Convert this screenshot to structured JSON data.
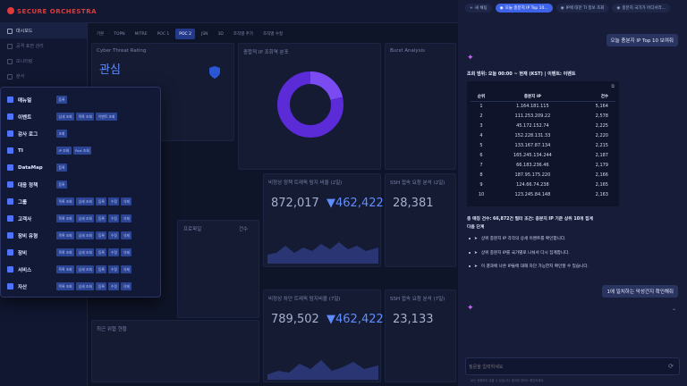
{
  "app": {
    "logo": "SECURE ORCHESTRA"
  },
  "sidebar": {
    "items": [
      {
        "label": "대시보드"
      },
      {
        "label": "공격 표면 관리"
      },
      {
        "label": "모니터링"
      },
      {
        "label": "분석"
      },
      {
        "label": "대응"
      }
    ]
  },
  "main_tabs": [
    {
      "label": "기본"
    },
    {
      "label": "TOPN"
    },
    {
      "label": "MITRE"
    },
    {
      "label": "POC 1"
    },
    {
      "label": "POC 2"
    },
    {
      "label": "JSN"
    },
    {
      "label": "3D"
    },
    {
      "label": "조직별 추가"
    },
    {
      "label": "조직별 수정"
    }
  ],
  "panels": {
    "cyber": {
      "title": "Cyber Threat Rating",
      "value": "관심"
    },
    "donut": {
      "title": "종합적 IP 조회역 분포"
    },
    "burst": {
      "title": "Burst Analysis"
    },
    "mid_left": {
      "title": "비정상 정책 트래픽 탐지 비율 (2일)",
      "v1": "872,017",
      "v2": "462,422"
    },
    "mid_right": {
      "title": "SSH 접속 요청 분석 (2일)",
      "v1": "28,381"
    },
    "low_left": {
      "title": "비정상 차단 트래픽 탐지비율 (7일)",
      "v1": "789,502",
      "v2": "462,422"
    },
    "low_right": {
      "title": "SSH 접속 요청 분석 (7일)",
      "v1": "23,133"
    },
    "recent": {
      "title": "최근 위협 현황"
    },
    "profile": {
      "h1": "프로파일",
      "h2": "건수"
    }
  },
  "menu": {
    "items": [
      {
        "label": "매뉴얼",
        "chips": [
          "등록"
        ]
      },
      {
        "label": "이벤트",
        "chips": [
          "상세 조회",
          "목록 조회",
          "이벤트 조회"
        ]
      },
      {
        "label": "감사 로그",
        "chips": [
          "조회"
        ]
      },
      {
        "label": "TI",
        "chips": [
          "IP 조회",
          "Port 조회"
        ]
      },
      {
        "label": "DataMap",
        "chips": [
          "등록"
        ]
      },
      {
        "label": "대응 정책",
        "chips": [
          "등록"
        ]
      },
      {
        "label": "그룹",
        "chips": [
          "목록 조회",
          "상세 조회",
          "등록",
          "수정",
          "삭제"
        ]
      },
      {
        "label": "고객사",
        "chips": [
          "목록 조회",
          "상세 조회",
          "등록",
          "수정",
          "삭제"
        ]
      },
      {
        "label": "장비 유형",
        "chips": [
          "목록 조회",
          "상세 조회",
          "등록",
          "수정",
          "삭제"
        ]
      },
      {
        "label": "장비",
        "chips": [
          "목록 조회",
          "상세 조회",
          "등록",
          "수정",
          "삭제"
        ]
      },
      {
        "label": "서비스",
        "chips": [
          "목록 조회",
          "상세 조회",
          "등록",
          "수정",
          "삭제"
        ]
      },
      {
        "label": "자산",
        "chips": [
          "목록 조회",
          "상세 조회",
          "등록",
          "수정",
          "삭제"
        ]
      }
    ]
  },
  "chat": {
    "tabs": [
      {
        "label": "새 채팅"
      },
      {
        "label": "오늘 충분지 IP Top 10..."
      },
      {
        "label": "IP에 대한 TI 정보 조회"
      },
      {
        "label": "충분지 국가가 어디서라..."
      }
    ],
    "user_msg1": "오늘 충분지 IP Top 10 보여줘",
    "user_msg2": "1에 일치하는 악성건지 확인해줘",
    "response_header": "조회 범위: 오늘 00:00 ~ 현재 (KST) | 이벤트: 이벤트",
    "table": {
      "headers": [
        "순위",
        "충분지 IP",
        "건수"
      ],
      "rows": [
        [
          "1",
          "1.164.181.115",
          "5,164"
        ],
        [
          "2",
          "111.253.209.22",
          "2,578"
        ],
        [
          "3",
          "45.172.152.74",
          "2,225"
        ],
        [
          "4",
          "152.228.131.33",
          "2,220"
        ],
        [
          "5",
          "133.167.87.134",
          "2,215"
        ],
        [
          "6",
          "165.245.134.244",
          "2,187"
        ],
        [
          "7",
          "66.183.236.46",
          "2,179"
        ],
        [
          "8",
          "187.95.175.220",
          "2,166"
        ],
        [
          "9",
          "124.66.74.238",
          "2,165"
        ],
        [
          "10",
          "123.245.84.148",
          "2,163"
        ]
      ]
    },
    "summary": "총 매칭 건수: 66,872건 필터 조건: 충분지 IP 기준 상위 10개 집계",
    "next_steps": "다음 단계",
    "suggestions": [
      "상위 충분지 IP 각각의 상세 이벤트를 확인합니다.",
      "상위 충분지 IP를 국가별로 나눠서 다시 집계합니다.",
      "이 결과에 나온 IP들에 대해 차단 가능한지 확인할 수 있습니다."
    ],
    "input_placeholder": "질문을 입력하세요",
    "disclaimer": "AI는 정확하지 않을 수 있습니다. 중요한 정보는 확인하세요."
  },
  "colors": {
    "accent": "#3e63e8",
    "brand": "#e03a3a",
    "donut": "#5a2bd6"
  }
}
